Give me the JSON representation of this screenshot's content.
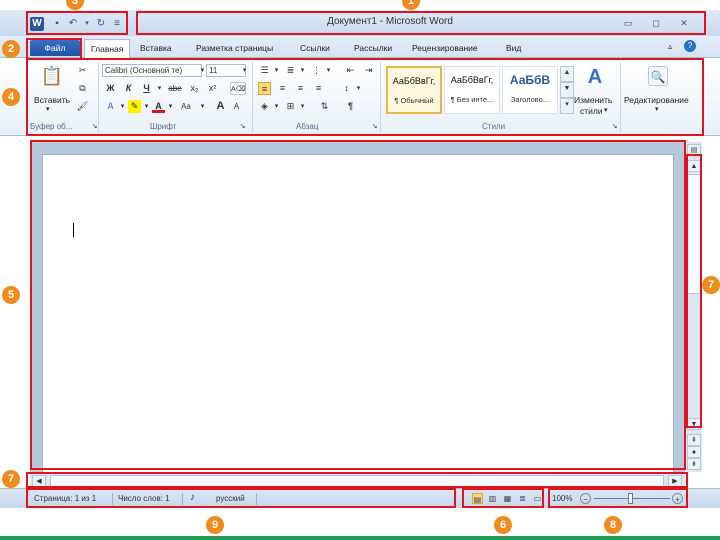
{
  "window": {
    "title": "Документ1 - Microsoft Word",
    "minimize_icon": "minimize-icon",
    "restore_icon": "restore-icon",
    "close_icon": "close-icon"
  },
  "qat": {
    "word_icon": "W",
    "save_icon": "save-icon",
    "undo_icon": "undo-icon",
    "redo_icon": "redo-icon",
    "customize_icon": "dropdown-icon"
  },
  "tabs": {
    "file": "Файл",
    "items": [
      "Главная",
      "Вставка",
      "Разметка страницы",
      "Ссылки",
      "Рассылки",
      "Рецензирование",
      "Вид"
    ],
    "active": "Главная"
  },
  "ribbon": {
    "clipboard": {
      "paste_label": "Вставить",
      "group_label": "Буфер об..."
    },
    "font": {
      "font_name": "Calibri (Основной те)",
      "font_size": "11",
      "bold": "Ж",
      "italic": "К",
      "underline": "Ч",
      "strike": "abe",
      "subscript": "x₂",
      "superscript": "x²",
      "grow": "A",
      "shrink": "A",
      "color_a": "A",
      "aa_label": "Aa",
      "group_label": "Шрифт"
    },
    "paragraph": {
      "group_label": "Абзац",
      "pilcrow": "¶"
    },
    "styles": {
      "group_label": "Стили",
      "items": [
        {
          "sample": "АаБбВвГг,",
          "name": "¶ Обычный"
        },
        {
          "sample": "АаБбВвГг,",
          "name": "¶ Без инте..."
        },
        {
          "sample": "АаБбВ",
          "name": "Заголово..."
        }
      ],
      "change_styles_1": "Изменить",
      "change_styles_2": "стили"
    },
    "editing": {
      "label": "Редактирование"
    }
  },
  "statusbar": {
    "page": "Страница: 1 из 1",
    "words": "Число слов: 1",
    "language": "русский",
    "zoom": "100%"
  },
  "callouts": {
    "b1": "1",
    "b2": "2",
    "b3": "3",
    "b4": "4",
    "b5": "5",
    "b6": "6",
    "b7a": "7",
    "b7b": "7",
    "b8": "8",
    "b9": "9"
  },
  "colors": {
    "callout_red": "#e0141c",
    "badge_orange": "#f08c1e",
    "file_tab_blue": "#2b579a"
  }
}
